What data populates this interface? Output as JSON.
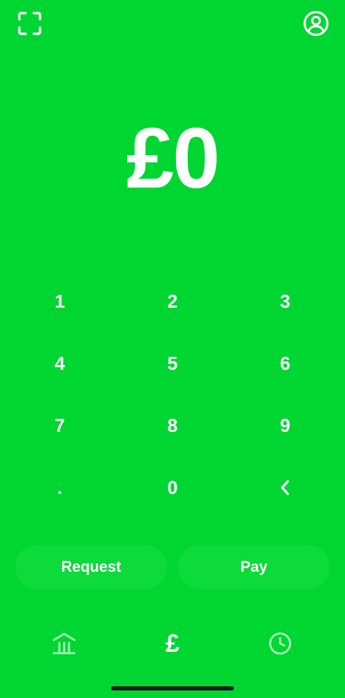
{
  "colors": {
    "background": "#00d632",
    "button_fill": "#0ddb3b",
    "foreground": "#ffffff",
    "inactive_tab": "#a9f5b8"
  },
  "top_bar": {
    "left_icon": "scan-icon",
    "right_icon": "profile-icon"
  },
  "amount": {
    "display": "£0"
  },
  "keypad": {
    "keys": [
      "1",
      "2",
      "3",
      "4",
      "5",
      "6",
      "7",
      "8",
      "9",
      ".",
      "0",
      "<"
    ]
  },
  "actions": {
    "request_label": "Request",
    "pay_label": "Pay"
  },
  "tab_bar": {
    "home_icon": "bank-icon",
    "money_symbol": "£",
    "activity_icon": "clock-icon",
    "active_tab": "money"
  }
}
